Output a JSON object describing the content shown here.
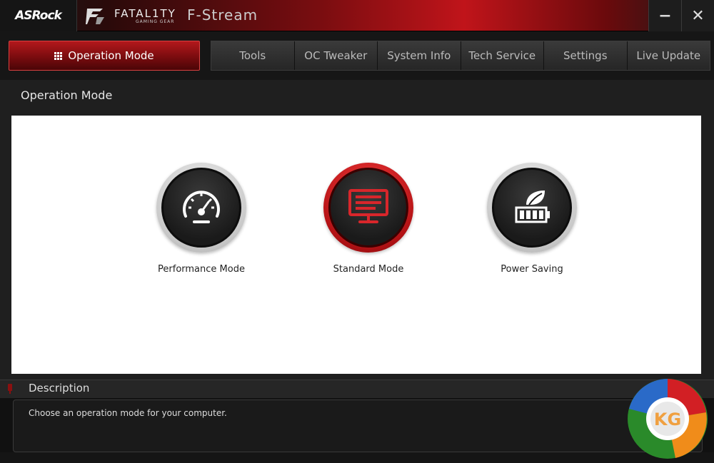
{
  "titlebar": {
    "brand": "ASRock",
    "product": "FATAL1TY",
    "product_sub": "GAMING GEAR",
    "app_title": "F-Stream",
    "minimize_label": "−",
    "close_label": "✕"
  },
  "nav": {
    "active_label": "Operation Mode",
    "tabs": [
      {
        "label": "Tools"
      },
      {
        "label": "OC Tweaker"
      },
      {
        "label": "System Info"
      },
      {
        "label": "Tech Service"
      },
      {
        "label": "Settings"
      },
      {
        "label": "Live Update"
      }
    ]
  },
  "section": {
    "title": "Operation Mode"
  },
  "modes": [
    {
      "label": "Performance Mode",
      "icon": "speedometer-icon",
      "selected": false
    },
    {
      "label": "Standard Mode",
      "icon": "monitor-icon",
      "selected": true
    },
    {
      "label": "Power Saving",
      "icon": "leaf-battery-icon",
      "selected": false
    }
  ],
  "description": {
    "title": "Description",
    "text": "Choose an operation mode for your computer."
  },
  "watermark": {
    "text": "KG"
  },
  "colors": {
    "accent": "#c0141a",
    "panel": "#ffffff",
    "background": "#1f1f1f"
  }
}
